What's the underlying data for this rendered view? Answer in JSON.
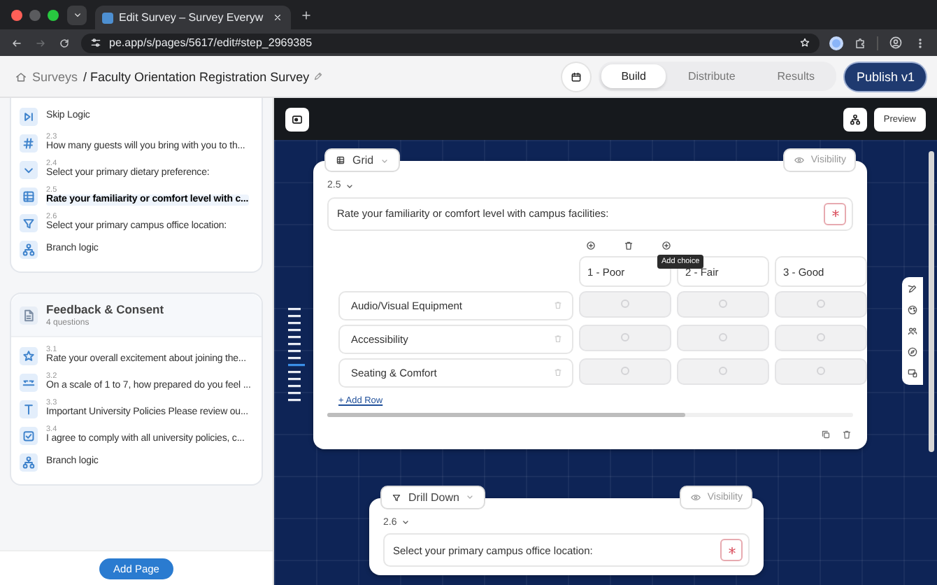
{
  "browser": {
    "tab_title": "Edit Survey – Survey Everyw",
    "url": "pe.app/s/pages/5617/edit#step_2969385"
  },
  "header": {
    "root_link": "Surveys",
    "survey_title": "/ Faculty Orientation Registration Survey",
    "view_tabs": [
      {
        "label": "Build",
        "selected": true
      },
      {
        "label": "Distribute",
        "selected": false
      },
      {
        "label": "Results",
        "selected": false
      }
    ],
    "publish_button": "Publish v1"
  },
  "sidebar": {
    "sections": [
      {
        "items": [
          {
            "kind": "skip_logic",
            "label": "Skip Logic",
            "selected": false
          },
          {
            "kind": "number",
            "number": "2.3",
            "label": "How many guests will you bring with you to th...",
            "selected": false
          },
          {
            "kind": "dropdown",
            "number": "2.4",
            "label": "Select your primary dietary preference:",
            "selected": false
          },
          {
            "kind": "grid",
            "number": "2.5",
            "label": "Rate your familiarity or comfort level with c...",
            "selected": true
          },
          {
            "kind": "drill_down",
            "number": "2.6",
            "label": "Select your primary campus office location:",
            "selected": false
          },
          {
            "kind": "branch_logic",
            "label": "Branch logic",
            "selected": false
          }
        ]
      },
      {
        "title": "Feedback & Consent",
        "subtitle": "4 questions",
        "items": [
          {
            "kind": "rating",
            "number": "3.1",
            "label": "Rate your overall excitement about joining the...",
            "selected": false
          },
          {
            "kind": "scale",
            "number": "3.2",
            "label": "On a scale of 1 to 7, how prepared do you feel ...",
            "selected": false
          },
          {
            "kind": "text",
            "number": "3.3",
            "label": "Important University Policies Please review ou...",
            "selected": false
          },
          {
            "kind": "consent",
            "number": "3.4",
            "label": "I agree to comply with all university policies, c...",
            "selected": false
          },
          {
            "kind": "branch_logic",
            "label": "Branch logic",
            "selected": false
          }
        ]
      }
    ],
    "add_page_button": "Add Page"
  },
  "editor": {
    "preview_button": "Preview",
    "questions": [
      {
        "kind": "grid",
        "type_label": "Grid",
        "visibility_button": "Visibility",
        "number": "2.5",
        "prompt": "Rate your familiarity or comfort level with campus facilities:",
        "required": true,
        "tooltip": "Add choice",
        "columns": [
          "1 - Poor",
          "2 - Fair",
          "3 - Good"
        ],
        "rows": [
          {
            "label": "Audio/Visual Equipment",
            "cells": [
              {
                "selected": false
              },
              {
                "selected": false
              },
              {
                "selected": false
              }
            ]
          },
          {
            "label": "Accessibility",
            "cells": [
              {
                "selected": false
              },
              {
                "selected": false
              },
              {
                "selected": false
              }
            ]
          },
          {
            "label": "Seating & Comfort",
            "cells": [
              {
                "selected": false
              },
              {
                "selected": false
              },
              {
                "selected": false
              }
            ]
          }
        ],
        "add_row_link": "+ Add Row"
      },
      {
        "kind": "drill_down",
        "type_label": "Drill Down",
        "visibility_button": "Visibility",
        "number": "2.6",
        "prompt": "Select your primary campus office location:",
        "required": true
      }
    ]
  }
}
